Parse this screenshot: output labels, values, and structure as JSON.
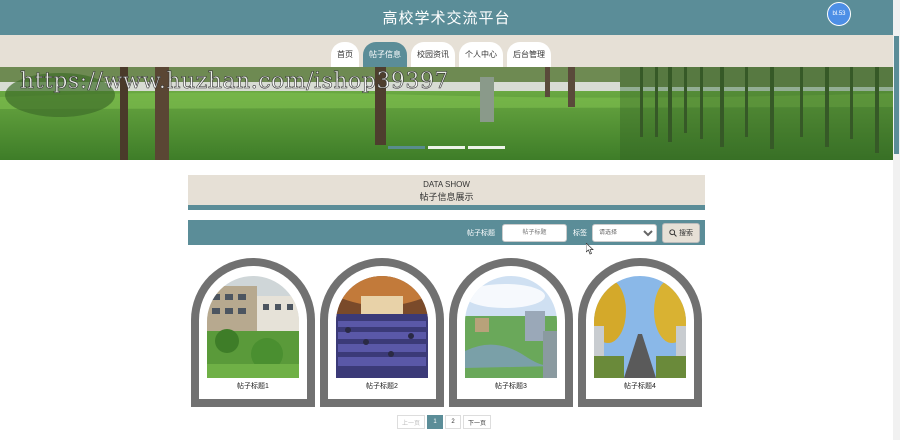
{
  "header": {
    "title": "高校学术交流平台",
    "avatar_text": "bl.53"
  },
  "nav": {
    "items": [
      "首页",
      "帖子信息",
      "校园资讯",
      "个人中心",
      "后台管理"
    ],
    "active_index": 1
  },
  "banner": {
    "watermark": "https://www.huzhan.com/ishop39397",
    "slide_count": 3,
    "active_slide": 0
  },
  "section": {
    "title_en": "DATA SHOW",
    "title_cn": "帖子信息展示"
  },
  "search": {
    "title_label": "帖子标题",
    "title_placeholder": "帖子标题",
    "tag_label": "标签",
    "tag_selected": "请选择",
    "button_label": "搜索"
  },
  "posts": [
    {
      "caption": "帖子标题1",
      "image": "campus-building-photo"
    },
    {
      "caption": "帖子标题2",
      "image": "auditorium-photo"
    },
    {
      "caption": "帖子标题3",
      "image": "campus-aerial-photo"
    },
    {
      "caption": "帖子标题4",
      "image": "ginkgo-avenue-photo"
    }
  ],
  "pagination": {
    "prev": "上一页",
    "pages": [
      "1",
      "2"
    ],
    "next": "下一页",
    "current": "1"
  },
  "colors": {
    "primary": "#5b8d98",
    "beige": "#e6e0d6",
    "card_frame": "#717171"
  }
}
